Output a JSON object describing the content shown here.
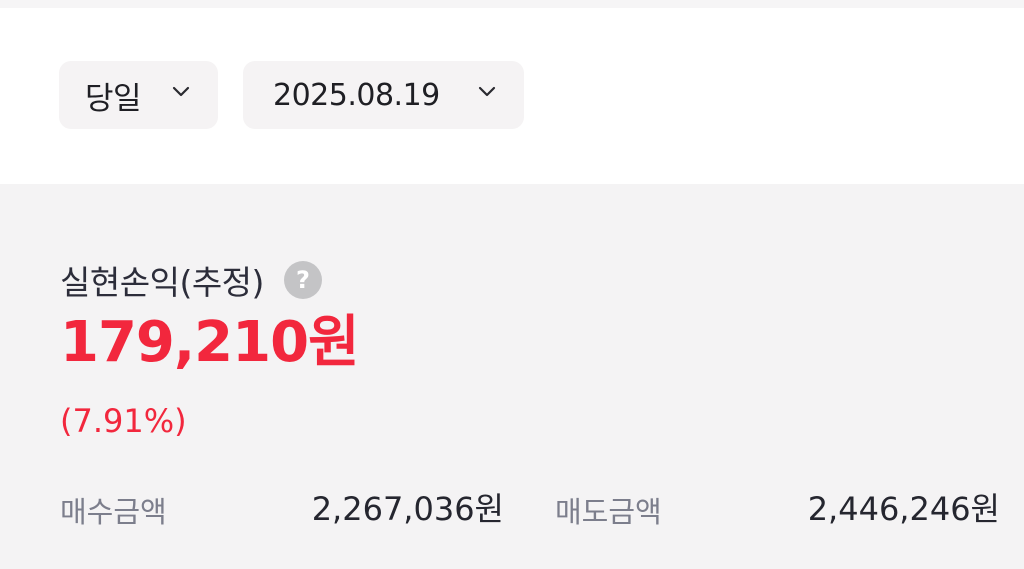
{
  "filters": {
    "period": {
      "label": "당일",
      "icon": "chevron-down-icon"
    },
    "date": {
      "label": "2025.08.19",
      "icon": "chevron-down-icon"
    }
  },
  "summary": {
    "title": "실현손익(추정)",
    "help_icon": "?",
    "amount": "179,210원",
    "rate": "(7.91%)",
    "buy": {
      "label": "매수금액",
      "value": "2,267,036원"
    },
    "sell": {
      "label": "매도금액",
      "value": "2,446,246원"
    }
  },
  "colors": {
    "profit": "#f2273d",
    "chip_bg": "#f5f3f4",
    "panel_bg": "#f4f3f4",
    "help_icon_bg": "#c4c4c6"
  }
}
